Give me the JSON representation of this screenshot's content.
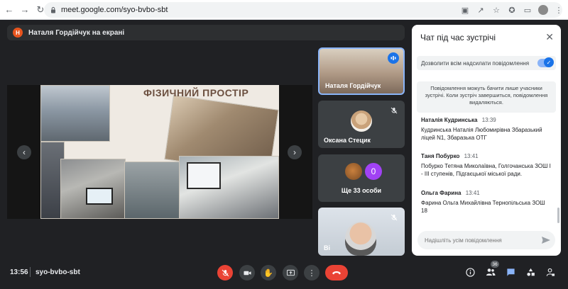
{
  "browser": {
    "url": "meet.google.com/syo-bvbo-sbt"
  },
  "banner": {
    "avatar_letter": "Н",
    "text": "Наталя Гордійчук на екрані"
  },
  "slide": {
    "title": "ФІЗИЧНИЙ ПРОСТІР"
  },
  "tiles": [
    {
      "name": "Наталя Гордійчук"
    },
    {
      "name": "Оксана Стецик"
    },
    {
      "more_count_label": "0",
      "more_label": "Ще 33 особи"
    },
    {
      "name": "Ві"
    }
  ],
  "chat": {
    "title": "Чат під час зустрічі",
    "allow_label": "Дозволити всім надсилати повідомлення",
    "notice": "Повідомлення можуть бачити лише учасники зустрічі. Коли зустріч завершиться, повідомлення видаляються.",
    "messages": [
      {
        "author": "Наталія Кудринська",
        "time": "13:39",
        "text": "Кудринська Наталія Любомирівна Збаразький ліцей N1, Збаразька ОТГ"
      },
      {
        "author": "Таня Побурко",
        "time": "13:41",
        "text": "Побурко Тетяна Миколаївна, Голгочанська ЗОШ I - III ступенів, Підгаєцької міської ради."
      },
      {
        "author": "Ольга Фарина",
        "time": "13:41",
        "text": "Фарина Ольга Михайлівна Тернопільська ЗОШ 18"
      }
    ],
    "input_placeholder": "Надішліть усім повідомлення"
  },
  "bottom": {
    "time": "13:56",
    "meeting_code": "syo-bvbo-sbt",
    "participants_badge": "36"
  },
  "colors": {
    "background": "#202124",
    "mic_off_red": "#ea4335",
    "accent_blue": "#1a73e8"
  }
}
